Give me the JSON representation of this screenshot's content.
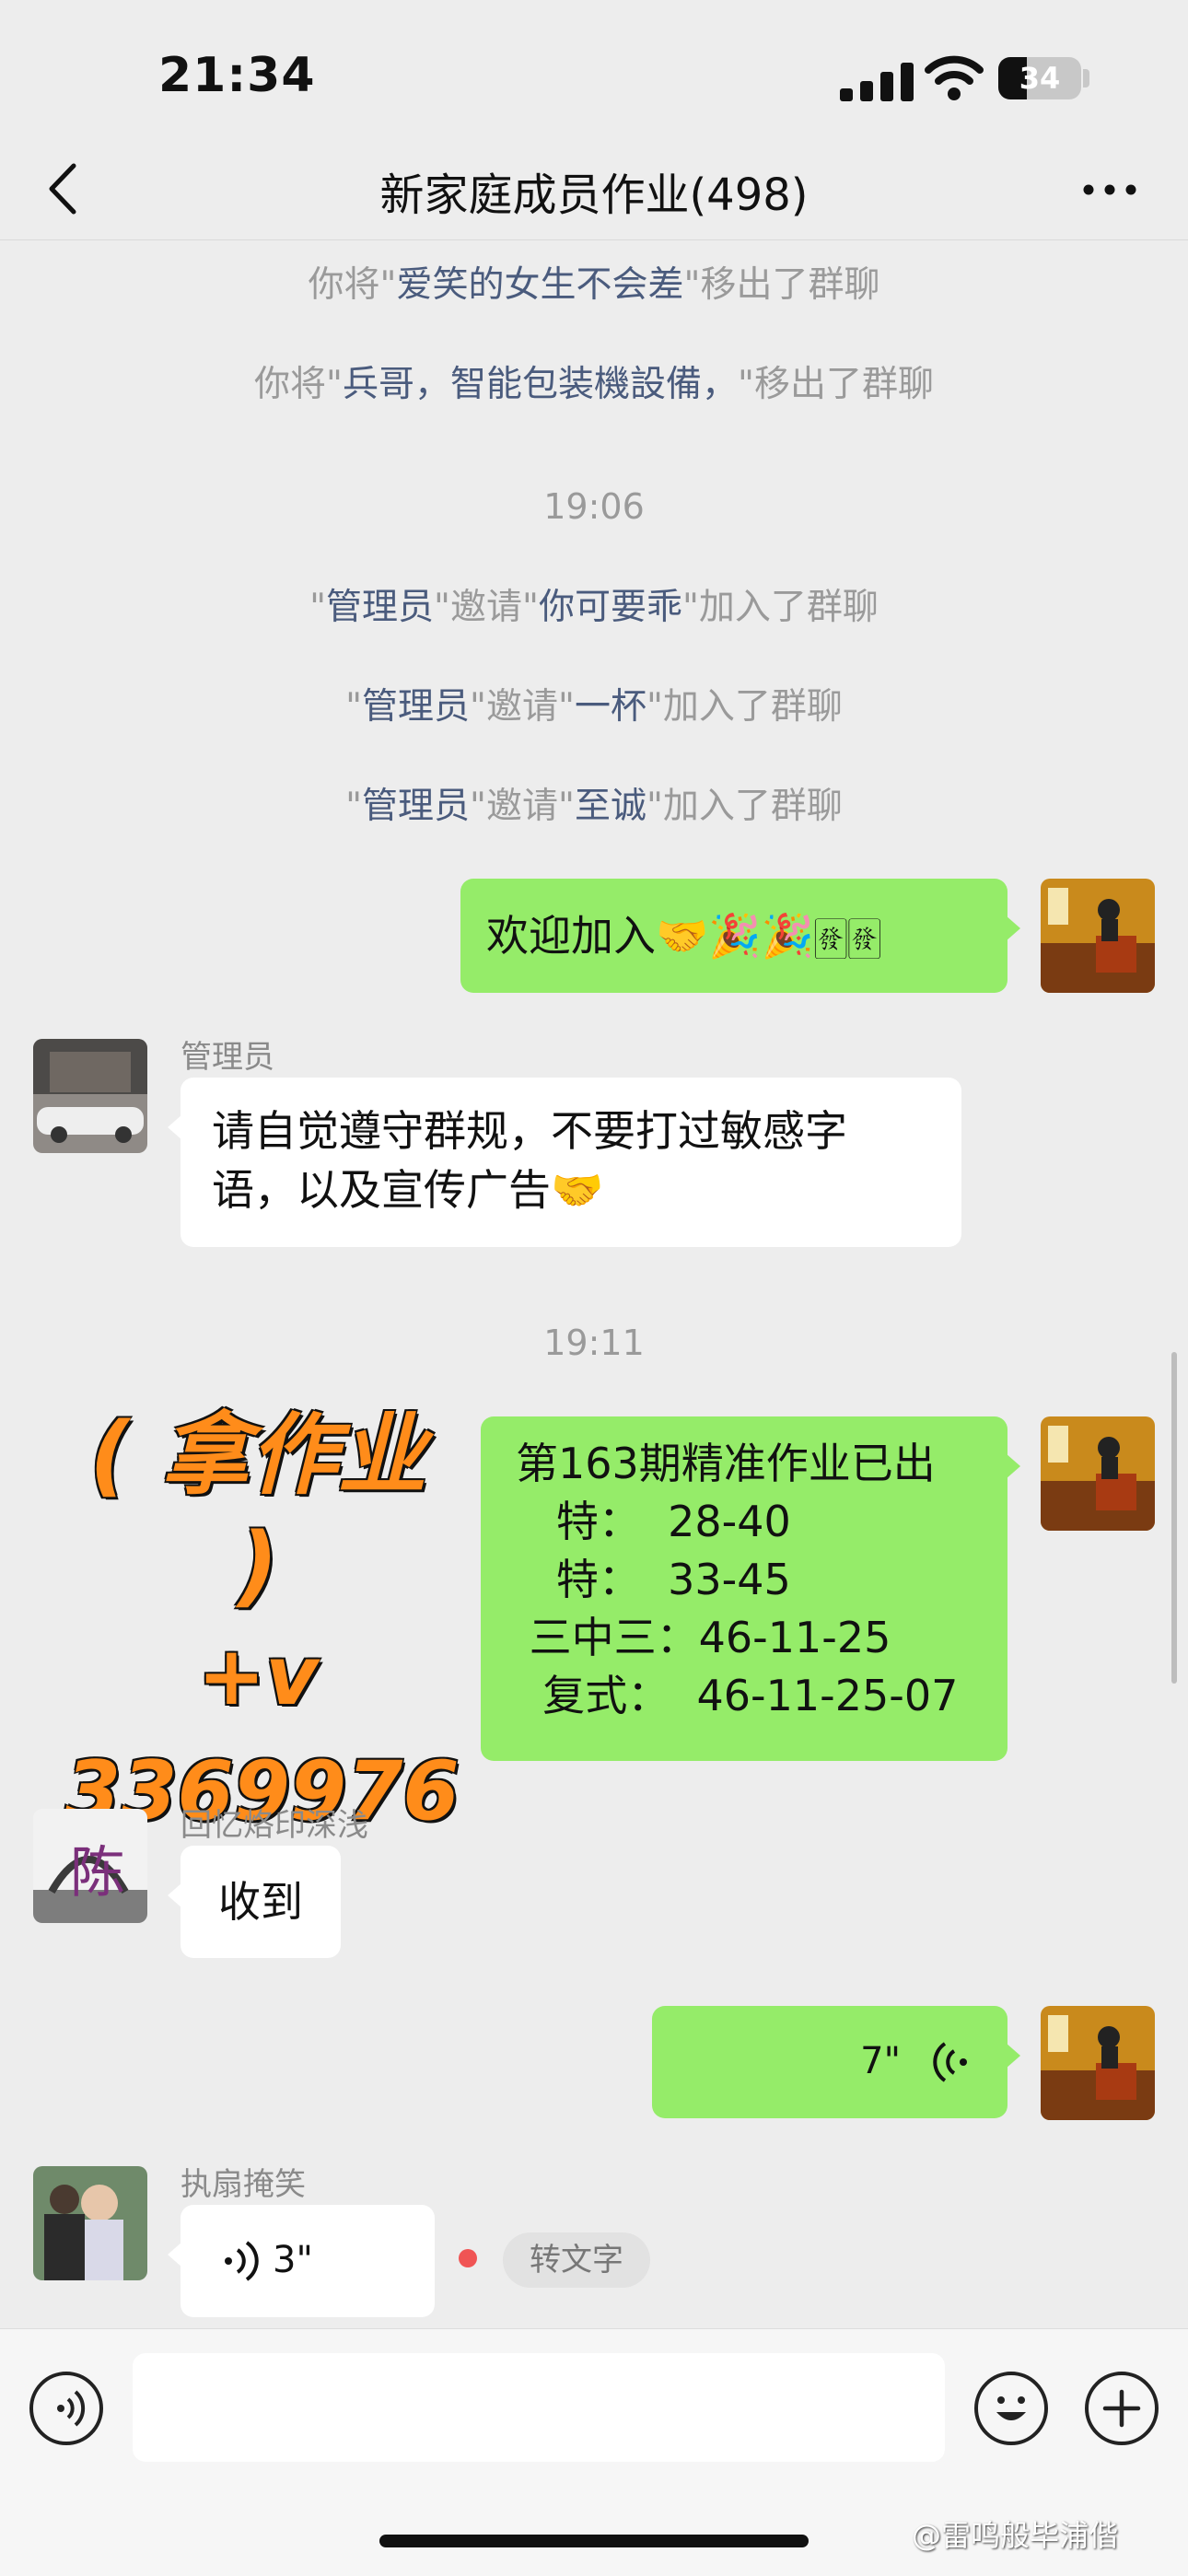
{
  "status_bar": {
    "time": "21:34",
    "battery": "34"
  },
  "nav": {
    "title": "新家庭成员作业(498)"
  },
  "system_msgs": [
    {
      "pre": "你将\"",
      "hl": "爱笑的女生不会差",
      "post": "\"移出了群聊"
    },
    {
      "pre": "你将\"",
      "hl": "兵哥，智能包装機設備，",
      "post": "\"移出了群聊"
    }
  ],
  "time_1906": "19:06",
  "invites": [
    {
      "q1": "\"",
      "admin": "管理员",
      "mid": "\"邀请\"",
      "who": "你可要乖",
      "tail": "\"加入了群聊"
    },
    {
      "q1": "\"",
      "admin": "管理员",
      "mid": "\"邀请\"",
      "who": "一杯",
      "tail": "\"加入了群聊"
    },
    {
      "q1": "\"",
      "admin": "管理员",
      "mid": "\"邀请\"",
      "who": "至诚",
      "tail": "\"加入了群聊"
    }
  ],
  "msg_welcome": "欢迎加入🤝🎉🎉🀅🀅",
  "admin_sender": "管理员",
  "admin_msg_line1": "请自觉遵守群规，不要打过敏感字",
  "admin_msg_line2": "语，以及宣传广告🤝",
  "time_1911": "19:11",
  "promo": {
    "line1": "( 拿作业 )",
    "line2": "+v",
    "line3": "3369976"
  },
  "lottery": {
    "line1": "第163期精准作业已出",
    "line2": "   特：  28-40",
    "line3": "   特：  33-45",
    "line4": " 三中三：46-11-25",
    "line5": "  复式：  46-11-25-07"
  },
  "sender2": "回忆烙印深浅",
  "msg_received": "收到",
  "voice_out": "7\"",
  "sender3": "执扇掩笑",
  "voice_in": "3\"",
  "to_text": "转文字",
  "watermark": "@雷鸣般毕浦偕",
  "icons": [
    "back-icon",
    "more-icon",
    "voice-icon",
    "emoji-icon",
    "plus-icon",
    "wifi-icon",
    "signal-icon",
    "battery-icon"
  ]
}
